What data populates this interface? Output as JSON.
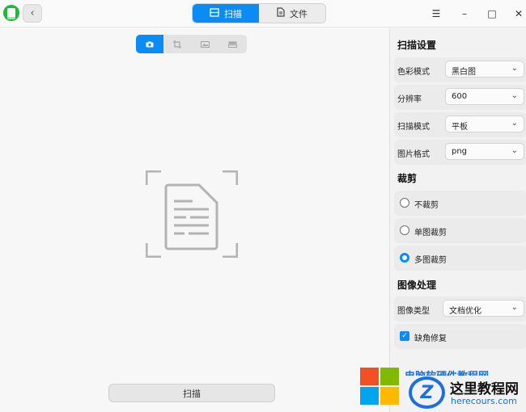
{
  "titlebar": {
    "mode_tabs": [
      {
        "label": "扫描",
        "icon": "scan-icon",
        "active": true
      },
      {
        "label": "文件",
        "icon": "file-icon",
        "active": false
      }
    ],
    "window_controls": {
      "menu": "☰",
      "minimize": "–",
      "maximize": "□",
      "close": "✕"
    }
  },
  "main": {
    "view_tabs": [
      {
        "icon": "camera-icon",
        "active": true
      },
      {
        "icon": "crop-icon",
        "active": false
      },
      {
        "icon": "image-icon",
        "active": false
      },
      {
        "icon": "layers-icon",
        "active": false
      }
    ],
    "placeholder_icon": "document-icon",
    "scan_button": "扫描"
  },
  "panel": {
    "scan_settings": {
      "title": "扫描设置",
      "rows": [
        {
          "label": "色彩模式",
          "value": "黑白图"
        },
        {
          "label": "分辨率",
          "value": "600"
        },
        {
          "label": "扫描模式",
          "value": "平板"
        },
        {
          "label": "图片格式",
          "value": "png"
        }
      ]
    },
    "crop": {
      "title": "裁剪",
      "options": [
        {
          "label": "不裁剪",
          "checked": false
        },
        {
          "label": "单图裁剪",
          "checked": false
        },
        {
          "label": "多图裁剪",
          "checked": true
        }
      ]
    },
    "image_processing": {
      "title": "图像处理",
      "type_label": "图像类型",
      "type_value": "文档优化",
      "repair_label": "缺角修复",
      "repair_checked": true
    }
  },
  "watermark": {
    "line1": "电脑软硬件教程网",
    "logo_letter": "Z",
    "line2": "这里教程网",
    "line3": "herecours.com"
  },
  "colors": {
    "accent": "#0b8cf5",
    "app_icon": "#1eb83a"
  }
}
